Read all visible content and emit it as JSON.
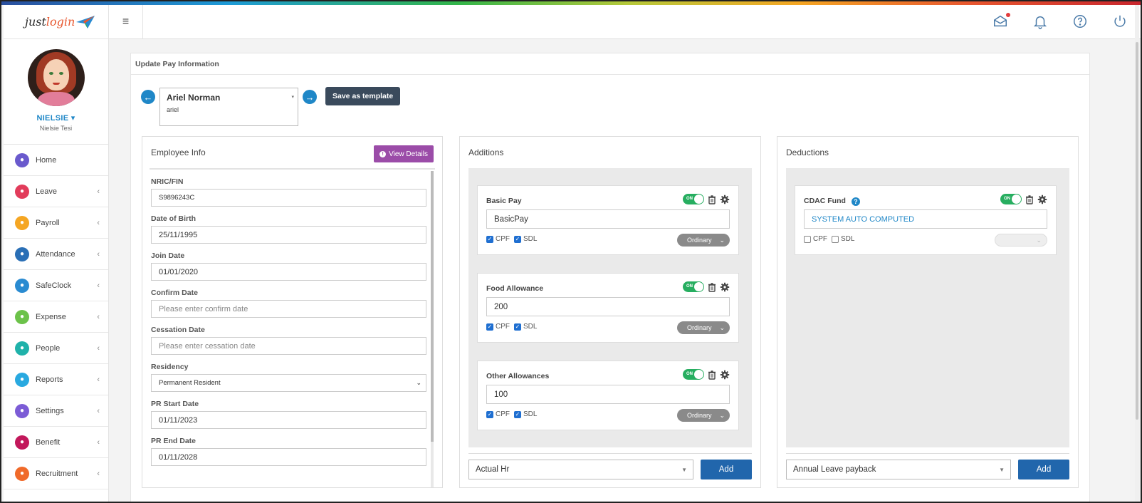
{
  "brand": {
    "logo_part1": "just",
    "logo_part2": "login"
  },
  "user": {
    "username": "NIELSIE",
    "caret": "▾",
    "full_name": "Nielsie Tesi"
  },
  "sidebar": {
    "items": [
      {
        "label": "Home",
        "icon": "home-icon",
        "color": "#6a5acd",
        "chev": ""
      },
      {
        "label": "Leave",
        "icon": "calendar-icon",
        "color": "#e23c5b",
        "chev": "‹"
      },
      {
        "label": "Payroll",
        "icon": "money-icon",
        "color": "#f5a623",
        "chev": "‹"
      },
      {
        "label": "Attendance",
        "icon": "clock-icon",
        "color": "#2a6fb6",
        "chev": "‹"
      },
      {
        "label": "SafeClock",
        "icon": "clock-icon",
        "color": "#2a8bd1",
        "chev": "‹"
      },
      {
        "label": "Expense",
        "icon": "receipt-icon",
        "color": "#6cc24a",
        "chev": "‹"
      },
      {
        "label": "People",
        "icon": "people-icon",
        "color": "#20b2aa",
        "chev": "‹"
      },
      {
        "label": "Reports",
        "icon": "chart-icon",
        "color": "#29a9e0",
        "chev": "‹"
      },
      {
        "label": "Settings",
        "icon": "gear-icon",
        "color": "#7c5cd6",
        "chev": "‹"
      },
      {
        "label": "Benefit",
        "icon": "heart-icon",
        "color": "#c2185b",
        "chev": "‹"
      },
      {
        "label": "Recruitment",
        "icon": "search-icon",
        "color": "#f06a2a",
        "chev": "‹"
      }
    ]
  },
  "topbar": {
    "menu": "≡"
  },
  "page": {
    "title": "Update Pay Information",
    "save_template": "Save as template"
  },
  "employee": {
    "name": "Ariel Norman",
    "sub": "ariel",
    "caret": "▾"
  },
  "employee_info": {
    "title": "Employee Info",
    "view_details": "View Details",
    "fields": [
      {
        "label": "NRIC/FIN",
        "value": "S9896243C"
      },
      {
        "label": "Date of Birth",
        "value": "25/11/1995"
      },
      {
        "label": "Join Date",
        "value": "01/01/2020"
      },
      {
        "label": "Confirm Date",
        "placeholder": "Please enter confirm date"
      },
      {
        "label": "Cessation Date",
        "placeholder": "Please enter cessation date"
      },
      {
        "label": "Residency",
        "value": "Permanent Resident"
      },
      {
        "label": "PR Start Date",
        "value": "01/11/2023"
      },
      {
        "label": "PR End Date",
        "value": "01/11/2028"
      }
    ]
  },
  "additions": {
    "title": "Additions",
    "items": [
      {
        "name": "Basic Pay",
        "value": "BasicPay",
        "toggle": "ON",
        "cpf": "CPF",
        "sdl": "SDL",
        "type": "Ordinary"
      },
      {
        "name": "Food Allowance",
        "value": "200",
        "toggle": "ON",
        "cpf": "CPF",
        "sdl": "SDL",
        "type": "Ordinary"
      },
      {
        "name": "Other Allowances",
        "value": "100",
        "toggle": "ON",
        "cpf": "CPF",
        "sdl": "SDL",
        "type": "Ordinary"
      }
    ],
    "select_value": "Actual Hr",
    "add_label": "Add"
  },
  "deductions": {
    "title": "Deductions",
    "items": [
      {
        "name": "CDAC Fund",
        "help": "?",
        "value": "SYSTEM AUTO COMPUTED",
        "toggle": "ON",
        "cpf": "CPF",
        "sdl": "SDL"
      }
    ],
    "select_value": "Annual Leave payback",
    "add_label": "Add"
  }
}
